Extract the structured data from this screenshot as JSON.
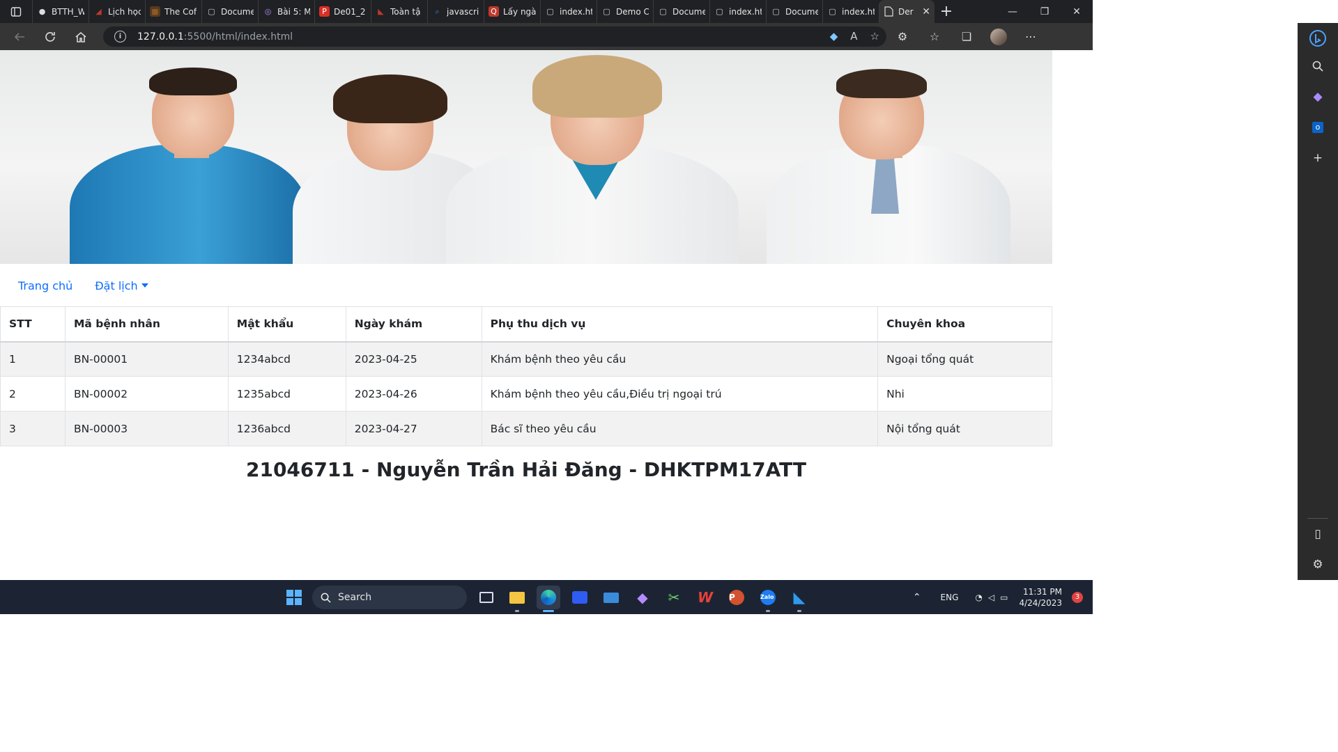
{
  "browser": {
    "tabs": [
      {
        "label": "BTTH_W",
        "icon": "github-icon"
      },
      {
        "label": "Lịch học",
        "icon": "calendar-icon"
      },
      {
        "label": "The Cof",
        "icon": "coffee-icon"
      },
      {
        "label": "Docume",
        "icon": "document-icon"
      },
      {
        "label": "Bài 5: M",
        "icon": "course-icon"
      },
      {
        "label": "De01_2",
        "icon": "pdf-icon"
      },
      {
        "label": "Toàn tậ",
        "icon": "bookmark-icon"
      },
      {
        "label": "javascri",
        "icon": "search-icon"
      },
      {
        "label": "Lấy ngà",
        "icon": "qa-icon"
      },
      {
        "label": "index.ht",
        "icon": "document-icon"
      },
      {
        "label": "Demo C",
        "icon": "document-icon"
      },
      {
        "label": "Docume",
        "icon": "document-icon"
      },
      {
        "label": "index.ht",
        "icon": "document-icon"
      },
      {
        "label": "Docume",
        "icon": "document-icon"
      },
      {
        "label": "index.ht",
        "icon": "document-icon"
      }
    ],
    "active_tab": {
      "label": "Der",
      "icon": "document-icon"
    },
    "url_host": "127.0.0.1",
    "url_path": ":5500/html/index.html"
  },
  "nav": {
    "home": "Trang chủ",
    "booking": "Đặt lịch"
  },
  "table": {
    "headers": [
      "STT",
      "Mã bệnh nhân",
      "Mật khẩu",
      "Ngày khám",
      "Phụ thu dịch vụ",
      "Chuyên khoa"
    ],
    "rows": [
      [
        "1",
        "BN-00001",
        "1234abcd",
        "2023-04-25",
        "Khám bệnh theo yêu cầu",
        "Ngoại tổng quát"
      ],
      [
        "2",
        "BN-00002",
        "1235abcd",
        "2023-04-26",
        "Khám bệnh theo yêu cầu,Điều trị ngoại trú",
        "Nhi"
      ],
      [
        "3",
        "BN-00003",
        "1236abcd",
        "2023-04-27",
        "Bác sĩ theo yêu cầu",
        "Nội tổng quát"
      ]
    ]
  },
  "footer": {
    "title": "21046711 - Nguyễn Trần Hải Đăng - DHKTPM17ATT"
  },
  "taskbar": {
    "search": "Search",
    "language": "ENG",
    "time": "11:31 PM",
    "date": "4/24/2023",
    "notification_count": "3"
  },
  "colors": {
    "link": "#0d6efd",
    "stripe": "#f2f2f2",
    "chrome_dark": "#202124",
    "taskbar": "#1c2433"
  }
}
